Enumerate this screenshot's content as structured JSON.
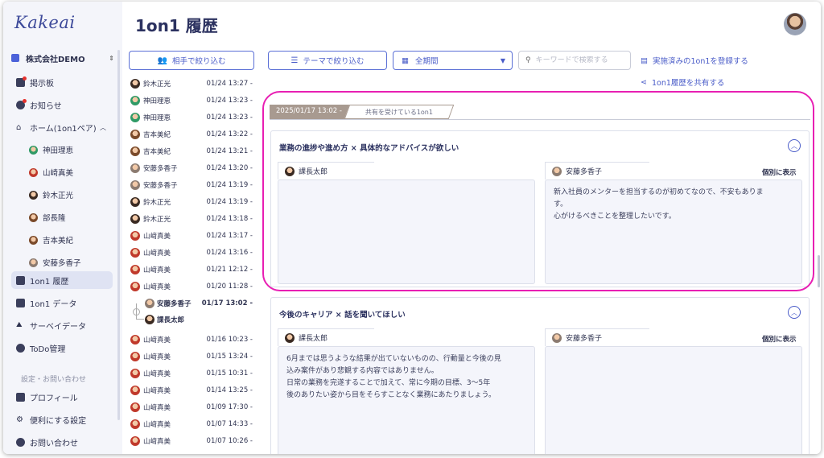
{
  "app": {
    "logo": "Kakeai",
    "page_title": "1on1 履歴"
  },
  "sidebar": {
    "company": "株式会社DEMO",
    "items": [
      {
        "label": "掲示板",
        "icon": "grid-icon"
      },
      {
        "label": "お知らせ",
        "icon": "bell-icon"
      },
      {
        "label": "ホーム(1on1ペア)",
        "icon": "home-icon"
      }
    ],
    "pairs": [
      "神田理恵",
      "山崎真美",
      "鈴木正光",
      "部長隆",
      "吉本美紀",
      "安藤多香子"
    ],
    "nav2": [
      {
        "label": "1on1 履歴",
        "icon": "history-icon"
      },
      {
        "label": "1on1 データ",
        "icon": "bar-chart-icon"
      },
      {
        "label": "サーベイデータ",
        "icon": "survey-icon"
      },
      {
        "label": "ToDo管理",
        "icon": "check-circle-icon"
      }
    ],
    "settings_label": "設定・お問い合わせ",
    "settings": [
      {
        "label": "プロフィール",
        "icon": "profile-icon"
      },
      {
        "label": "便利にする設定",
        "icon": "gear-icon"
      },
      {
        "label": "お問い合わせ",
        "icon": "help-icon"
      }
    ]
  },
  "filters": {
    "partner": "相手で絞り込む",
    "theme": "テーマで絞り込む",
    "period": "全期間",
    "search_placeholder": "キーワードで検索する",
    "register": "実施済みの1on1を登録する",
    "share": "1on1履歴を共有する"
  },
  "history": [
    {
      "name": "鈴木正光",
      "date": "01/24 13:27 -",
      "av": "dark"
    },
    {
      "name": "神田理恵",
      "date": "01/24 13:23 -",
      "av": "green"
    },
    {
      "name": "神田理恵",
      "date": "01/24 13:23 -",
      "av": "green"
    },
    {
      "name": "吉本美紀",
      "date": "01/24 13:22 -",
      "av": "brown"
    },
    {
      "name": "吉本美紀",
      "date": "01/24 13:21 -",
      "av": "brown"
    },
    {
      "name": "安藤多香子",
      "date": "01/24 13:20 -",
      "av": "gray"
    },
    {
      "name": "安藤多香子",
      "date": "01/24 13:19 -",
      "av": "gray"
    },
    {
      "name": "鈴木正光",
      "date": "01/24 13:19 -",
      "av": "dark"
    },
    {
      "name": "鈴木正光",
      "date": "01/24 13:18 -",
      "av": "dark"
    },
    {
      "name": "山﨑真美",
      "date": "01/24 13:17 -",
      "av": "red"
    },
    {
      "name": "山﨑真美",
      "date": "01/24 13:16 -",
      "av": "red"
    },
    {
      "name": "山﨑真美",
      "date": "01/21 12:12 -",
      "av": "red"
    },
    {
      "name": "山﨑真美",
      "date": "01/20 11:28 -",
      "av": "red"
    }
  ],
  "history_group": {
    "name": "安藤多香子",
    "name2": "課長太郎",
    "date": "01/17 13:02 -"
  },
  "history2": [
    {
      "name": "山﨑真美",
      "date": "01/16 10:23 -",
      "av": "red"
    },
    {
      "name": "山﨑真美",
      "date": "01/15 13:24 -",
      "av": "red"
    },
    {
      "name": "山﨑真美",
      "date": "01/15 10:31 -",
      "av": "red"
    },
    {
      "name": "山﨑真美",
      "date": "01/14 13:25 -",
      "av": "red"
    },
    {
      "name": "山﨑真美",
      "date": "01/09 17:30 -",
      "av": "red"
    },
    {
      "name": "山﨑真美",
      "date": "01/07 14:33 -",
      "av": "red"
    },
    {
      "name": "山﨑真美",
      "date": "01/07 10:26 -",
      "av": "red"
    }
  ],
  "meeting": {
    "date_tab": "2025/01/17 13:02 -",
    "shared_tab": "共有を受けている1on1"
  },
  "card1": {
    "title": "業務の進捗や進め方 × 具体的なアドバイスが欲しい",
    "left_name": "課長太郎",
    "right_name": "安藤多香子",
    "individual": "個別に表示",
    "right_text": [
      "新入社員のメンターを担当するのが初めてなので、不安もありま",
      "す。",
      "心がけるべきことを整理したいです。"
    ]
  },
  "card2": {
    "title": "今後のキャリア × 話を聞いてほしい",
    "left_name": "課長太郎",
    "right_name": "安藤多香子",
    "individual": "個別に表示",
    "left_text": [
      "6月までは思うような結果が出ていないものの、行動量と今後の見",
      "込み案件があり悲観する内容ではありません。",
      "日常の業務を完遂することで加えて、常に今期の目標、3〜5年",
      "後のありたい姿から目をそらすことなく業務にあたりましょう。"
    ]
  },
  "colors": {
    "accent": "#4a5cc8",
    "highlight": "#e81fb3",
    "tab_date": "#a89a90"
  }
}
